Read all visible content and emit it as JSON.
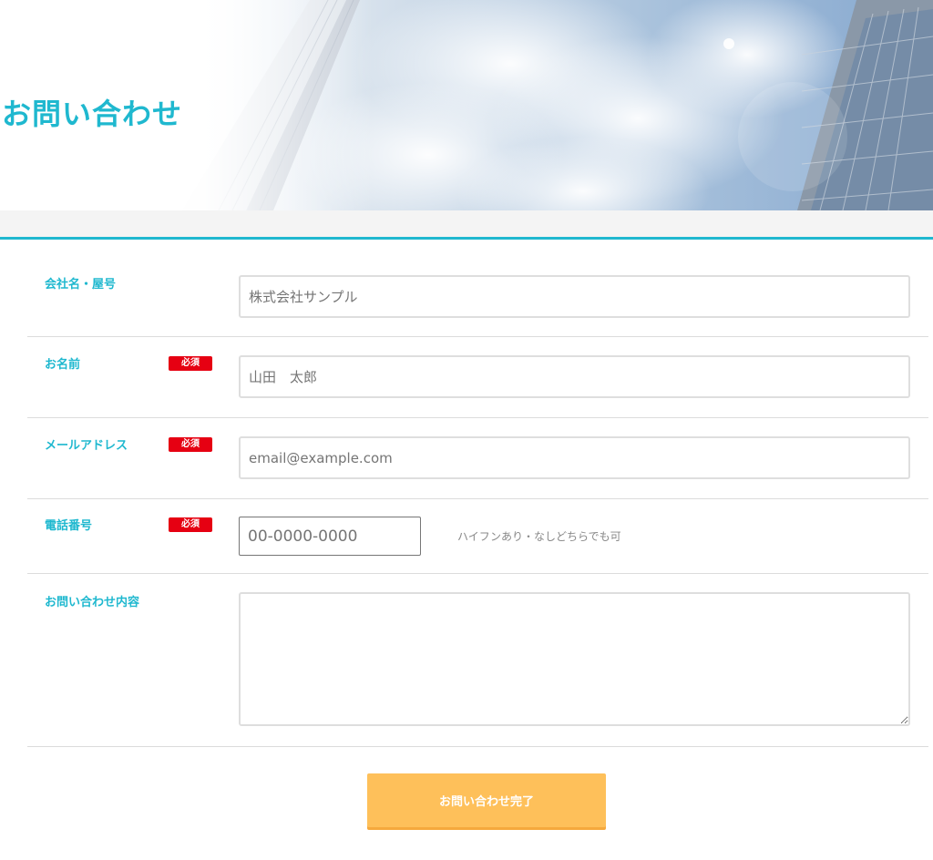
{
  "page": {
    "title": "お問い合わせ"
  },
  "colors": {
    "accent": "#1fb8cf",
    "required": "#e60012",
    "submit": "#fec05a"
  },
  "form": {
    "required_badge": "必須",
    "company": {
      "label": "会社名・屋号",
      "placeholder": "株式会社サンプル",
      "value": ""
    },
    "name": {
      "label": "お名前",
      "placeholder": "山田　太郎",
      "value": ""
    },
    "email": {
      "label": "メールアドレス",
      "placeholder": "email@example.com",
      "value": ""
    },
    "phone": {
      "label": "電話番号",
      "placeholder": "00-0000-0000",
      "value": "",
      "hint": "ハイフンあり・なしどちらでも可"
    },
    "message": {
      "label": "お問い合わせ内容",
      "value": ""
    },
    "submit_label": "お問い合わせ完了"
  }
}
